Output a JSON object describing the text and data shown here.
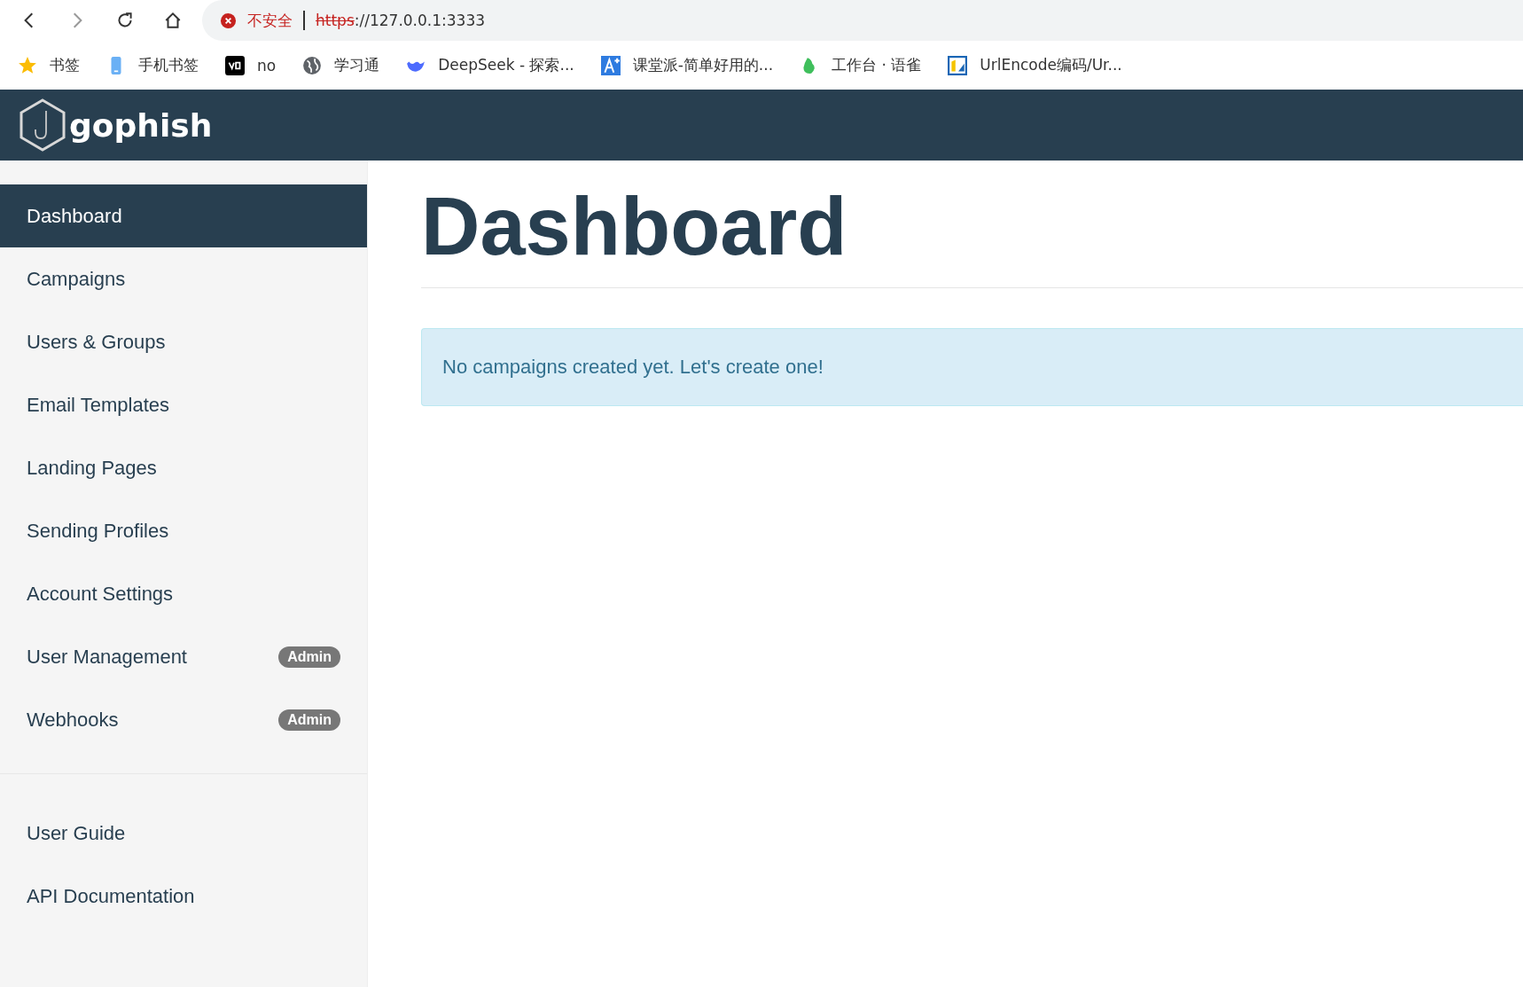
{
  "browser": {
    "security_label": "不安全",
    "url_scheme": "https",
    "url_rest": "://127.0.0.1:3333"
  },
  "bookmarks": [
    {
      "label": "书签",
      "kind": "star"
    },
    {
      "label": "手机书签",
      "kind": "phone"
    },
    {
      "label": "no",
      "kind": "v0"
    },
    {
      "label": "学习通",
      "kind": "globe"
    },
    {
      "label": "DeepSeek - 探索...",
      "kind": "whale"
    },
    {
      "label": "课堂派-简单好用的...",
      "kind": "aplus"
    },
    {
      "label": "工作台 · 语雀",
      "kind": "leaf"
    },
    {
      "label": "UrlEncode编码/Ur...",
      "kind": "tile"
    }
  ],
  "navbar": {
    "brand": "gophish"
  },
  "sidebar": {
    "items": [
      {
        "label": "Dashboard",
        "selected": true
      },
      {
        "label": "Campaigns",
        "selected": false
      },
      {
        "label": "Users & Groups",
        "selected": false
      },
      {
        "label": "Email Templates",
        "selected": false
      },
      {
        "label": "Landing Pages",
        "selected": false
      },
      {
        "label": "Sending Profiles",
        "selected": false
      },
      {
        "label": "Account Settings",
        "selected": false
      },
      {
        "label": "User Management",
        "selected": false,
        "badge": "Admin"
      },
      {
        "label": "Webhooks",
        "selected": false,
        "badge": "Admin"
      }
    ],
    "links": [
      {
        "label": "User Guide"
      },
      {
        "label": "API Documentation"
      }
    ]
  },
  "page": {
    "title": "Dashboard",
    "alert": "No campaigns created yet. Let's create one!"
  }
}
